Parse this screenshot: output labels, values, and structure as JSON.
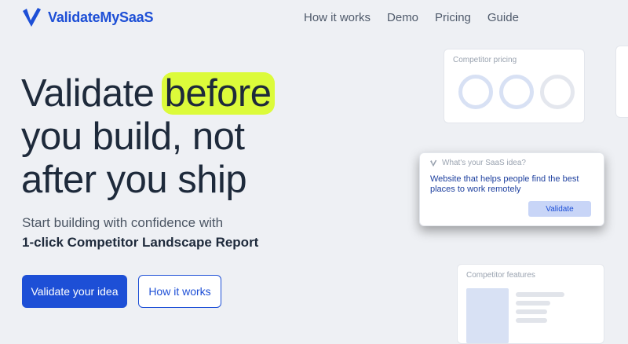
{
  "brand": {
    "name": "ValidateMySaaS",
    "logo_icon": "check-v-logo",
    "accent": "#1d4fd6",
    "highlight": "#dcfb3a"
  },
  "nav": {
    "items": [
      "How it works",
      "Demo",
      "Pricing",
      "Guide"
    ]
  },
  "hero": {
    "title_pre": "Validate ",
    "title_highlight": "before",
    "title_line2": "you build, not",
    "title_line3": "after you ship",
    "subtitle_line1": "Start building with confidence with",
    "subtitle_line2": "1-click Competitor Landscape Report",
    "primary_cta": "Validate your idea",
    "secondary_cta": "How it works"
  },
  "cards": {
    "pricing": {
      "title": "Competitor pricing"
    },
    "idea": {
      "label": "What's your SaaS idea?",
      "text": "Website that helps people find the best places to work remotely",
      "button": "Validate"
    },
    "features": {
      "title": "Competitor features"
    }
  }
}
